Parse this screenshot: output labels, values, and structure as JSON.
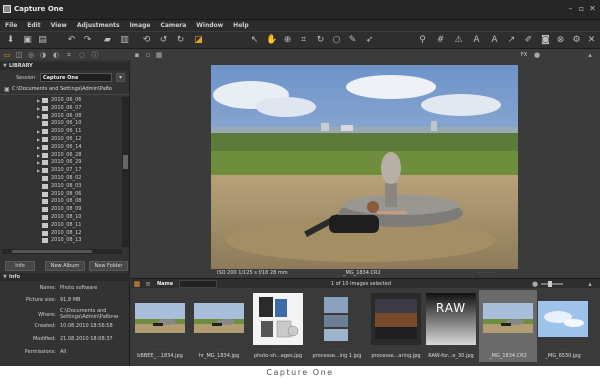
{
  "window": {
    "title": "Capture One",
    "controls": [
      "minimize-icon",
      "maximize-icon",
      "close-icon"
    ]
  },
  "menu": [
    "File",
    "Edit",
    "View",
    "Adjustments",
    "Image",
    "Camera",
    "Window",
    "Help"
  ],
  "toolbar": {
    "left_icons": [
      "import-icon",
      "capture-icon",
      "process-icon",
      "rotate-left-icon",
      "rotate-right-icon",
      "folder-icon",
      "trash-icon",
      "undo-icon",
      "redo-icon",
      "forward-icon",
      "compare-icon"
    ],
    "center_icons": [
      "select-cursor-icon",
      "pan-hand-icon",
      "zoom-icon",
      "crop-icon",
      "straighten-icon",
      "spot-removal-icon",
      "white-balance-picker-icon",
      "copy-adjustments-icon"
    ],
    "right_icons": [
      "search-icon",
      "grid-icon",
      "warning-icon",
      "text-icon",
      "text-large-icon",
      "arrow-icon",
      "pen-icon",
      "camera-icon",
      "exposure-icon",
      "settings-icon",
      "tools-icon"
    ]
  },
  "library": {
    "section_title": "LIBRARY",
    "session_label": "Session",
    "session_value": "Capture One",
    "path": "C:\\Documents and Settings\\Admin\\Рабо",
    "folders": [
      {
        "name": "2010_06_06",
        "expandable": true
      },
      {
        "name": "2010_06_07",
        "expandable": true
      },
      {
        "name": "2010_06_08",
        "expandable": true
      },
      {
        "name": "2010_06_10",
        "expandable": false
      },
      {
        "name": "2010_06_11",
        "expandable": true
      },
      {
        "name": "2010_06_12",
        "expandable": true
      },
      {
        "name": "2010_06_14",
        "expandable": true
      },
      {
        "name": "2010_06_28",
        "expandable": true
      },
      {
        "name": "2010_06_29",
        "expandable": true
      },
      {
        "name": "2010_07_17",
        "expandable": true
      },
      {
        "name": "2010_08_02",
        "expandable": false
      },
      {
        "name": "2010_08_03",
        "expandable": false
      },
      {
        "name": "2010_08_06",
        "expandable": false
      },
      {
        "name": "2010_08_08",
        "expandable": false
      },
      {
        "name": "2010_08_09",
        "expandable": false
      },
      {
        "name": "2010_08_10",
        "expandable": false
      },
      {
        "name": "2010_08_11",
        "expandable": false
      },
      {
        "name": "2010_08_12",
        "expandable": false
      },
      {
        "name": "2010_08_13",
        "expandable": false
      }
    ],
    "buttons": {
      "info": "Info",
      "new_album": "New Album",
      "new_folder": "New Folder"
    }
  },
  "info": {
    "section_title": "Info",
    "rows": [
      {
        "label": "Name:",
        "value": "Photo software"
      },
      {
        "label": "Picture size:",
        "value": "91,8 MB"
      },
      {
        "label": "Where:",
        "value": "C:\\Documents and Settings\\Admin\\Рабочи"
      },
      {
        "label": "Created:",
        "value": "10.08.2010 18:56:58"
      },
      {
        "label": "Modified:",
        "value": "21.08.2010 18:08:37"
      },
      {
        "label": "Permissions:",
        "value": "All"
      }
    ]
  },
  "viewer": {
    "right_label": "FX",
    "meta_left": "ISO 200  1/125 s  f/18  28 mm",
    "filename": "_MG_1834.CR2"
  },
  "browser": {
    "sort_label": "Name",
    "count_text": "1 of 10 images selected",
    "thumbnails": [
      {
        "label": "bBBEE_...1834.jpg",
        "kind": "photo",
        "selected": false
      },
      {
        "label": "hr_MG_1834.jpg",
        "kind": "photo",
        "selected": false
      },
      {
        "label": "photo-sh...ages.jpg",
        "kind": "boxes",
        "selected": false
      },
      {
        "label": "processe...ing 1.jpg",
        "kind": "stack",
        "selected": false
      },
      {
        "label": "processe...aring.jpg",
        "kind": "dark",
        "selected": false
      },
      {
        "label": "RAW-for...e_30.jpg",
        "kind": "raw",
        "raw_text": "RAW",
        "selected": false
      },
      {
        "label": "_MG_1834.CR2",
        "kind": "photo",
        "selected": true
      },
      {
        "label": "_MG_6530.jpg",
        "kind": "sky",
        "selected": false
      }
    ]
  },
  "caption": "Capture One",
  "colors": {
    "background": "#3a3a3a",
    "titlebar": "#262626",
    "accent_orange": "#e8a030",
    "panel": "#333333"
  }
}
